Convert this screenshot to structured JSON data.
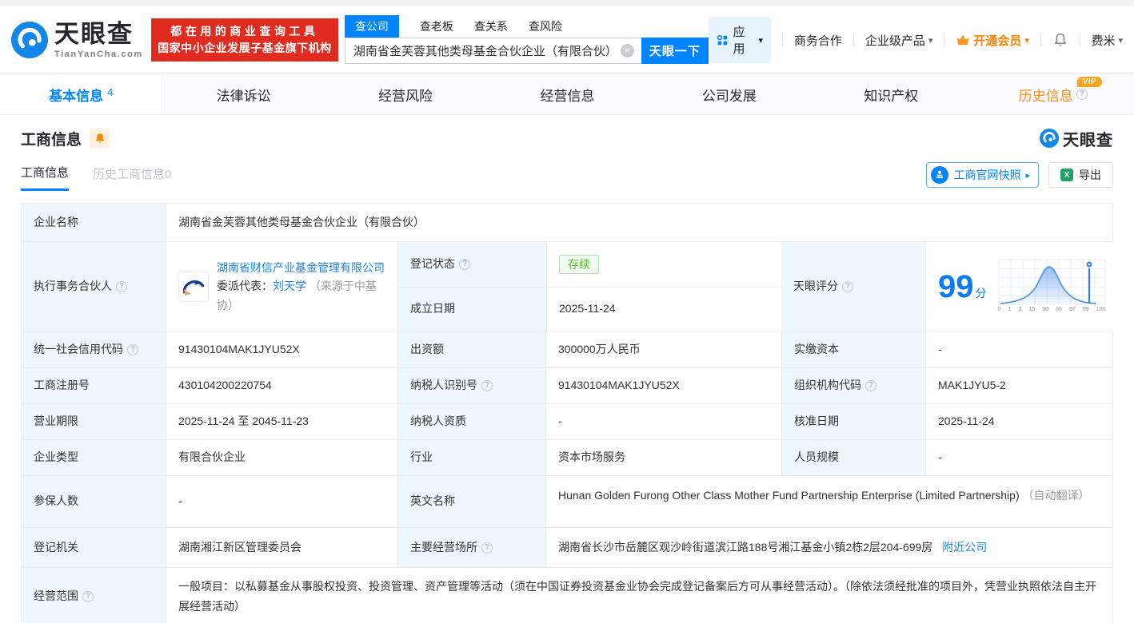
{
  "brand": {
    "name": "天眼查",
    "domain": "TianYanCha.com",
    "slogan1": "都在用的商业查询工具",
    "slogan2": "国家中小企业发展子基金旗下机构"
  },
  "search": {
    "tabs": [
      "查公司",
      "查老板",
      "查关系",
      "查风险"
    ],
    "value": "湖南省金芙蓉其他类母基金合伙企业（有限合伙）",
    "button": "天眼一下"
  },
  "topnav": {
    "apps": "应用",
    "cooperation": "商务合作",
    "enterprise": "企业级产品",
    "vip": "开通会员",
    "user": "费米"
  },
  "tabs": {
    "basic": "基本信息",
    "basic_count": "4",
    "legal": "法律诉讼",
    "risk": "经营风险",
    "operation": "经营信息",
    "development": "公司发展",
    "ip": "知识产权",
    "history": "历史信息",
    "history_vip": "VIP"
  },
  "section": {
    "title": "工商信息",
    "subtab_active": "工商信息",
    "subtab_history": "历史工商信息0",
    "snapshot_btn": "工商官网快照",
    "export_btn": "导出",
    "logo": "天眼查"
  },
  "info": {
    "name_label": "企业名称",
    "name": "湖南省金芙蓉其他类母基金合伙企业（有限合伙）",
    "partner_label": "执行事务合伙人",
    "partner_company": "湖南省财信产业基金管理有限公司",
    "rep_label": "委派代表：",
    "rep_name": "刘天学",
    "rep_source": "（来源于中基协）",
    "status_label": "登记状态",
    "status": "存续",
    "est_label": "成立日期",
    "est_date": "2025-11-24",
    "score_label": "天眼评分",
    "score": "99",
    "score_unit": "分",
    "credit_label": "统一社会信用代码",
    "credit": "91430104MAK1JYU52X",
    "capital_label": "出资额",
    "capital": "300000万人民币",
    "paid_label": "实缴资本",
    "paid": "-",
    "regno_label": "工商注册号",
    "regno": "430104200220754",
    "tax_label": "纳税人识别号",
    "tax": "91430104MAK1JYU52X",
    "orgcode_label": "组织机构代码",
    "orgcode": "MAK1JYU5-2",
    "term_label": "营业期限",
    "term": "2025-11-24 至 2045-11-23",
    "taxq_label": "纳税人资质",
    "taxq": "-",
    "approve_label": "核准日期",
    "approve": "2025-11-24",
    "type_label": "企业类型",
    "type": "有限合伙企业",
    "industry_label": "行业",
    "industry": "资本市场服务",
    "staff_label": "人员规模",
    "staff": "-",
    "insured_label": "参保人数",
    "insured": "-",
    "en_label": "英文名称",
    "en_name": "Hunan Golden Furong Other Class Mother Fund Partnership Enterprise (Limited Partnership)",
    "en_suffix": "（自动翻译）",
    "authority_label": "登记机关",
    "authority": "湖南湘江新区管理委员会",
    "address_label": "主要经营场所",
    "address": "湖南省长沙市岳麓区观沙岭街道滨江路188号湘江基金小镇2栋2层204-699房",
    "nearby": "附近公司",
    "scope_label": "经营范围",
    "scope": "一般项目：以私募基金从事股权投资、投资管理、资产管理等活动（须在中国证券投资基金业协会完成登记备案后方可从事经营活动）。（除依法须经批准的项目外，凭营业执照依法自主开展经营活动）"
  },
  "score_chart": {
    "type": "area",
    "ticks": [
      "0",
      "1",
      "3",
      "15",
      "50",
      "85",
      "97",
      "99",
      "100"
    ],
    "marker_value": "99"
  },
  "colors": {
    "brand_blue": "#0084ff",
    "brand_red": "#e02b20",
    "vip_orange": "#ff8000",
    "status_green": "#52c41a",
    "label_bg": "#eef7fd"
  },
  "icons": {
    "caret": "▾",
    "arrow": "▸",
    "clear": "×",
    "help": "?"
  }
}
